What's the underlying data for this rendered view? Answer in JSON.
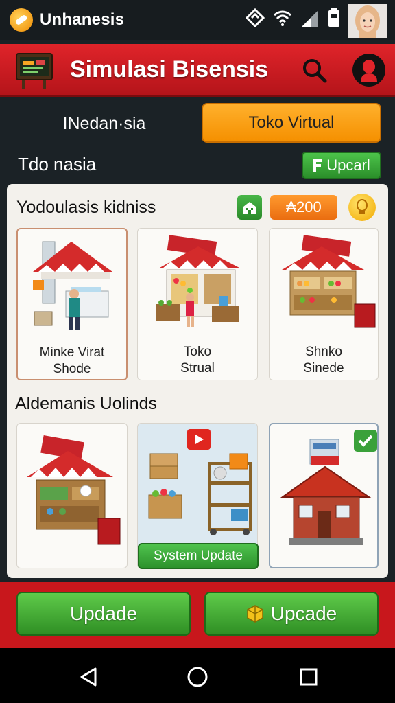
{
  "status_bar": {
    "app_name": "Unhanesis",
    "icons": [
      "nfc-icon",
      "wifi-icon",
      "signal-icon",
      "battery-icon"
    ]
  },
  "header": {
    "title": "Simulasi Bisensis"
  },
  "tabs": [
    {
      "label": "INedan·sia",
      "active": false
    },
    {
      "label": "Toko Virtual",
      "active": true
    }
  ],
  "section": {
    "title": "Tdo nasia",
    "upgrade_button": "Upcarl"
  },
  "panel": {
    "heading": "Yodoulasis kidniss",
    "coins": "₳200",
    "cards": [
      {
        "label_line1": "Minke Virat",
        "label_line2": "Shode",
        "selected": true
      },
      {
        "label_line1": "Toko",
        "label_line2": "Strual",
        "selected": false
      },
      {
        "label_line1": "Shnko",
        "label_line2": "Sinede",
        "selected": false
      }
    ],
    "section2_title": "Aldemanis Uolinds",
    "cards2": [
      {
        "name": "market-stall"
      },
      {
        "name": "system-update",
        "button": "System Update"
      },
      {
        "name": "red-house"
      }
    ]
  },
  "bottom_bar": {
    "left_button": "Updade",
    "right_button": "Upcade"
  },
  "colors": {
    "header_red": "#e0242a",
    "accent_orange": "#f59000",
    "button_green": "#2f8f24",
    "panel_bg": "#f3f1ec",
    "dark_bg": "#1b2226"
  }
}
